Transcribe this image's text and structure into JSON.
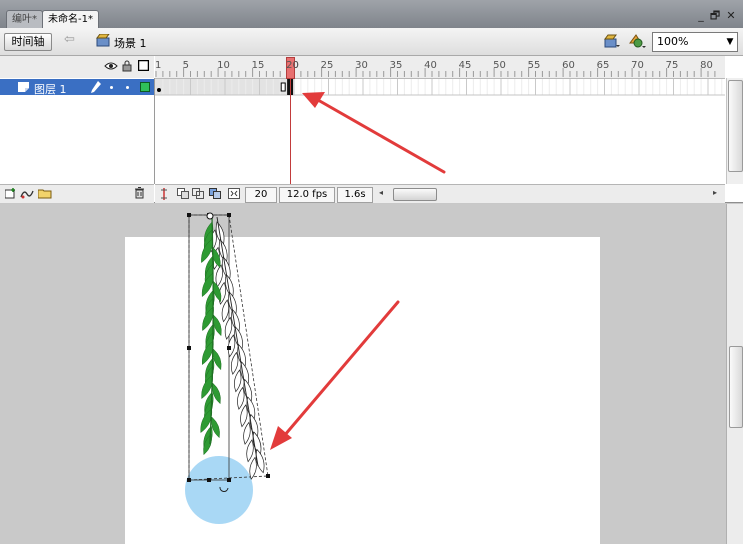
{
  "window": {
    "tabs": [
      {
        "label": "编叶*",
        "active": false
      },
      {
        "label": "未命名-1*",
        "active": true
      }
    ],
    "controls": {
      "minimize": "_",
      "restore": "🗗",
      "close": "✕"
    }
  },
  "toolbar": {
    "timeline_button": "时间轴",
    "scene_label": "场景 1",
    "zoom": {
      "selected": "100%"
    }
  },
  "timeline": {
    "ruler_ticks": [
      "1",
      "5",
      "10",
      "15",
      "20",
      "25",
      "30",
      "35",
      "40",
      "45",
      "50",
      "55",
      "60",
      "65",
      "70",
      "75",
      "80"
    ],
    "playhead_frame": 20,
    "layers": [
      {
        "name": "图层 1",
        "selected": true
      }
    ],
    "status": {
      "current_frame": "20",
      "fps": "12.0 fps",
      "elapsed": "1.6s"
    }
  },
  "icons": {
    "eye": "eye-icon",
    "lock": "lock-icon",
    "outline": "outline-square-icon",
    "pencil": "pencil-icon",
    "trash": "trash-icon"
  },
  "colors": {
    "layer_selected": "#3a6fc3",
    "playhead": "#e87070",
    "annotation_arrow": "#e23b3b",
    "leaf_green": "#2e9a33",
    "circle_fill": "#a9d8f5"
  }
}
